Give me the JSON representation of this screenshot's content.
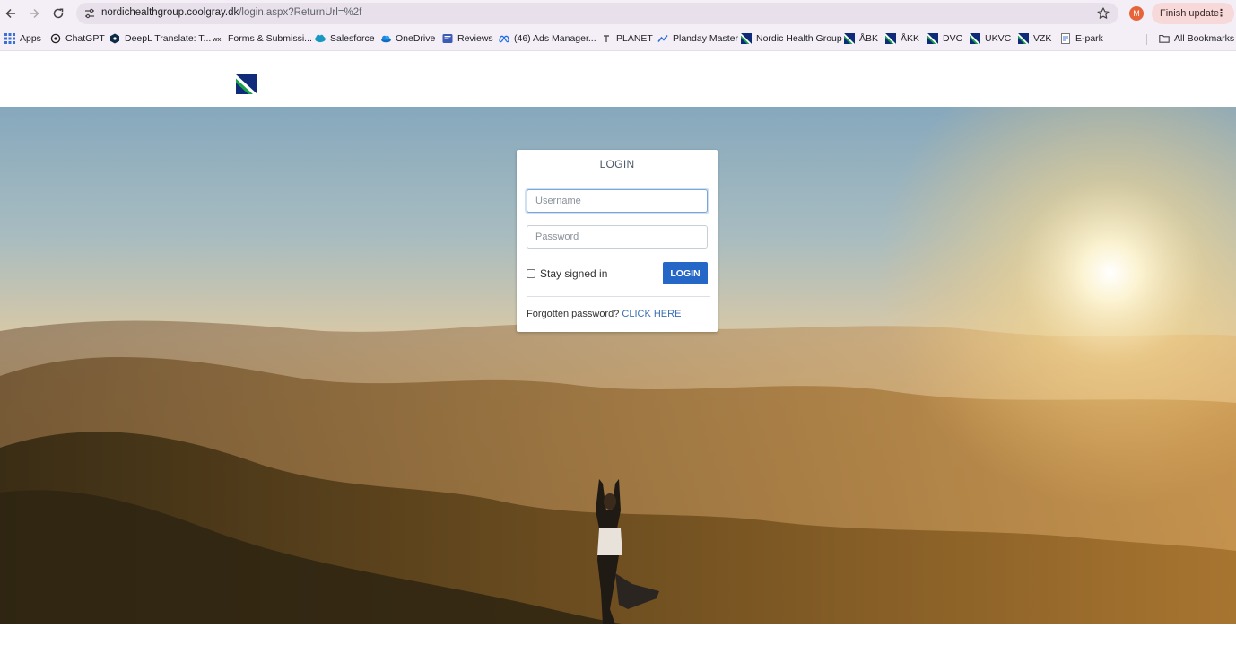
{
  "browser": {
    "url_host": "nordichealthgroup.coolgray.dk",
    "url_path": "/login.aspx?ReturnUrl=%2f",
    "profile_initial": "M",
    "update_button_label": "Finish update",
    "accent": "#e5643a"
  },
  "bookmarks": {
    "items": [
      {
        "label": "Apps",
        "icon": "apps-grid-icon"
      },
      {
        "label": "ChatGPT",
        "icon": "chatgpt-icon"
      },
      {
        "label": "DeepL Translate: T...",
        "icon": "deepl-icon"
      },
      {
        "label": "Forms & Submissi...",
        "icon": "forms-icon"
      },
      {
        "label": "Salesforce",
        "icon": "salesforce-icon"
      },
      {
        "label": "OneDrive",
        "icon": "onedrive-icon"
      },
      {
        "label": "Reviews",
        "icon": "reviews-icon"
      },
      {
        "label": "(46) Ads Manager...",
        "icon": "meta-icon"
      },
      {
        "label": "PLANET",
        "icon": "planet-icon"
      },
      {
        "label": "Planday Master",
        "icon": "planday-icon"
      },
      {
        "label": "Nordic Health Group",
        "icon": "nhg-logo-icon"
      },
      {
        "label": "ÅBK",
        "icon": "nhg-logo-icon"
      },
      {
        "label": "ÅKK",
        "icon": "nhg-logo-icon"
      },
      {
        "label": "DVC",
        "icon": "nhg-logo-icon"
      },
      {
        "label": "UKVC",
        "icon": "nhg-logo-icon"
      },
      {
        "label": "VZK",
        "icon": "nhg-logo-icon"
      },
      {
        "label": "E-park",
        "icon": "document-icon"
      }
    ],
    "all_bookmarks_label": "All Bookmarks"
  },
  "login": {
    "title": "LOGIN",
    "username_placeholder": "Username",
    "password_placeholder": "Password",
    "stay_signed_in_label": "Stay signed in",
    "login_button_label": "LOGIN",
    "forgot_text": "Forgotten password?",
    "forgot_link": "CLICK HERE",
    "button_color": "#2467c7"
  }
}
